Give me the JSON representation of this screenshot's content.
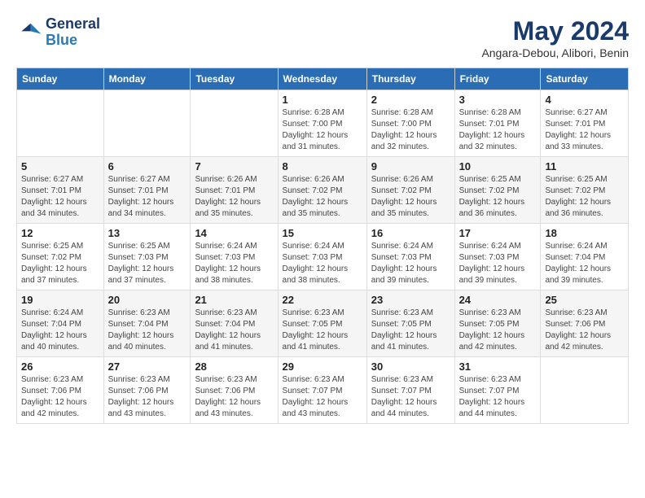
{
  "logo": {
    "line1": "General",
    "line2": "Blue"
  },
  "title": "May 2024",
  "subtitle": "Angara-Debou, Alibori, Benin",
  "header_days": [
    "Sunday",
    "Monday",
    "Tuesday",
    "Wednesday",
    "Thursday",
    "Friday",
    "Saturday"
  ],
  "weeks": [
    [
      {
        "day": "",
        "info": ""
      },
      {
        "day": "",
        "info": ""
      },
      {
        "day": "",
        "info": ""
      },
      {
        "day": "1",
        "info": "Sunrise: 6:28 AM\nSunset: 7:00 PM\nDaylight: 12 hours\nand 31 minutes."
      },
      {
        "day": "2",
        "info": "Sunrise: 6:28 AM\nSunset: 7:00 PM\nDaylight: 12 hours\nand 32 minutes."
      },
      {
        "day": "3",
        "info": "Sunrise: 6:28 AM\nSunset: 7:01 PM\nDaylight: 12 hours\nand 32 minutes."
      },
      {
        "day": "4",
        "info": "Sunrise: 6:27 AM\nSunset: 7:01 PM\nDaylight: 12 hours\nand 33 minutes."
      }
    ],
    [
      {
        "day": "5",
        "info": "Sunrise: 6:27 AM\nSunset: 7:01 PM\nDaylight: 12 hours\nand 34 minutes."
      },
      {
        "day": "6",
        "info": "Sunrise: 6:27 AM\nSunset: 7:01 PM\nDaylight: 12 hours\nand 34 minutes."
      },
      {
        "day": "7",
        "info": "Sunrise: 6:26 AM\nSunset: 7:01 PM\nDaylight: 12 hours\nand 35 minutes."
      },
      {
        "day": "8",
        "info": "Sunrise: 6:26 AM\nSunset: 7:02 PM\nDaylight: 12 hours\nand 35 minutes."
      },
      {
        "day": "9",
        "info": "Sunrise: 6:26 AM\nSunset: 7:02 PM\nDaylight: 12 hours\nand 35 minutes."
      },
      {
        "day": "10",
        "info": "Sunrise: 6:25 AM\nSunset: 7:02 PM\nDaylight: 12 hours\nand 36 minutes."
      },
      {
        "day": "11",
        "info": "Sunrise: 6:25 AM\nSunset: 7:02 PM\nDaylight: 12 hours\nand 36 minutes."
      }
    ],
    [
      {
        "day": "12",
        "info": "Sunrise: 6:25 AM\nSunset: 7:02 PM\nDaylight: 12 hours\nand 37 minutes."
      },
      {
        "day": "13",
        "info": "Sunrise: 6:25 AM\nSunset: 7:03 PM\nDaylight: 12 hours\nand 37 minutes."
      },
      {
        "day": "14",
        "info": "Sunrise: 6:24 AM\nSunset: 7:03 PM\nDaylight: 12 hours\nand 38 minutes."
      },
      {
        "day": "15",
        "info": "Sunrise: 6:24 AM\nSunset: 7:03 PM\nDaylight: 12 hours\nand 38 minutes."
      },
      {
        "day": "16",
        "info": "Sunrise: 6:24 AM\nSunset: 7:03 PM\nDaylight: 12 hours\nand 39 minutes."
      },
      {
        "day": "17",
        "info": "Sunrise: 6:24 AM\nSunset: 7:03 PM\nDaylight: 12 hours\nand 39 minutes."
      },
      {
        "day": "18",
        "info": "Sunrise: 6:24 AM\nSunset: 7:04 PM\nDaylight: 12 hours\nand 39 minutes."
      }
    ],
    [
      {
        "day": "19",
        "info": "Sunrise: 6:24 AM\nSunset: 7:04 PM\nDaylight: 12 hours\nand 40 minutes."
      },
      {
        "day": "20",
        "info": "Sunrise: 6:23 AM\nSunset: 7:04 PM\nDaylight: 12 hours\nand 40 minutes."
      },
      {
        "day": "21",
        "info": "Sunrise: 6:23 AM\nSunset: 7:04 PM\nDaylight: 12 hours\nand 41 minutes."
      },
      {
        "day": "22",
        "info": "Sunrise: 6:23 AM\nSunset: 7:05 PM\nDaylight: 12 hours\nand 41 minutes."
      },
      {
        "day": "23",
        "info": "Sunrise: 6:23 AM\nSunset: 7:05 PM\nDaylight: 12 hours\nand 41 minutes."
      },
      {
        "day": "24",
        "info": "Sunrise: 6:23 AM\nSunset: 7:05 PM\nDaylight: 12 hours\nand 42 minutes."
      },
      {
        "day": "25",
        "info": "Sunrise: 6:23 AM\nSunset: 7:06 PM\nDaylight: 12 hours\nand 42 minutes."
      }
    ],
    [
      {
        "day": "26",
        "info": "Sunrise: 6:23 AM\nSunset: 7:06 PM\nDaylight: 12 hours\nand 42 minutes."
      },
      {
        "day": "27",
        "info": "Sunrise: 6:23 AM\nSunset: 7:06 PM\nDaylight: 12 hours\nand 43 minutes."
      },
      {
        "day": "28",
        "info": "Sunrise: 6:23 AM\nSunset: 7:06 PM\nDaylight: 12 hours\nand 43 minutes."
      },
      {
        "day": "29",
        "info": "Sunrise: 6:23 AM\nSunset: 7:07 PM\nDaylight: 12 hours\nand 43 minutes."
      },
      {
        "day": "30",
        "info": "Sunrise: 6:23 AM\nSunset: 7:07 PM\nDaylight: 12 hours\nand 44 minutes."
      },
      {
        "day": "31",
        "info": "Sunrise: 6:23 AM\nSunset: 7:07 PM\nDaylight: 12 hours\nand 44 minutes."
      },
      {
        "day": "",
        "info": ""
      }
    ]
  ]
}
